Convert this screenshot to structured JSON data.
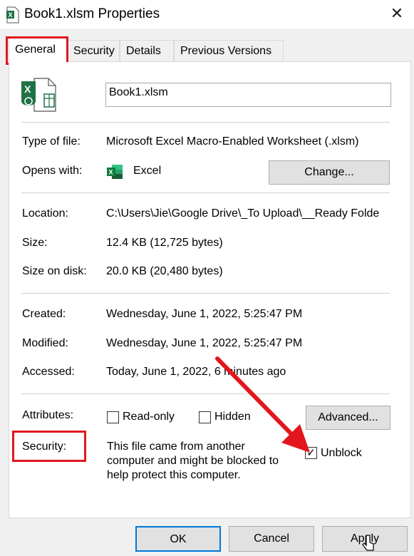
{
  "window": {
    "title": "Book1.xlsm Properties",
    "close_glyph": "✕"
  },
  "tabs": [
    {
      "label": "General"
    },
    {
      "label": "Security"
    },
    {
      "label": "Details"
    },
    {
      "label": "Previous Versions"
    }
  ],
  "file": {
    "name": "Book1.xlsm",
    "type_label": "Type of file:",
    "type_value": "Microsoft Excel Macro-Enabled Worksheet (.xlsm)",
    "opens_label": "Opens with:",
    "opens_value": "Excel",
    "change_button": "Change...",
    "location_label": "Location:",
    "location_value": "C:\\Users\\Jie\\Google Drive\\_To Upload\\__Ready Folde",
    "size_label": "Size:",
    "size_value": "12.4 KB (12,725 bytes)",
    "size_disk_label": "Size on disk:",
    "size_disk_value": "20.0 KB (20,480 bytes)",
    "created_label": "Created:",
    "created_value": "Wednesday, June 1, 2022, 5:25:47 PM",
    "modified_label": "Modified:",
    "modified_value": "Wednesday, June 1, 2022, 5:25:47 PM",
    "accessed_label": "Accessed:",
    "accessed_value": "Today, June 1, 2022, 6 minutes ago"
  },
  "attributes": {
    "label": "Attributes:",
    "readonly_label": "Read-only",
    "readonly_checked": false,
    "hidden_label": "Hidden",
    "hidden_checked": false,
    "advanced_button": "Advanced..."
  },
  "security": {
    "label": "Security:",
    "message_line1": "This file came from another",
    "message_line2": "computer and might be blocked to",
    "message_line3": "help protect this computer.",
    "unblock_label": "Unblock",
    "unblock_checked": true,
    "check_glyph": "✓"
  },
  "buttons": {
    "ok": "OK",
    "cancel": "Cancel",
    "apply": "Apply"
  },
  "colors": {
    "annotation_red": "#e3161e",
    "excel_green": "#1f7244"
  },
  "icons": [
    "excel-file-icon",
    "excel-app-icon",
    "close-icon",
    "red-arrow-annotation",
    "mouse-cursor-icon"
  ]
}
